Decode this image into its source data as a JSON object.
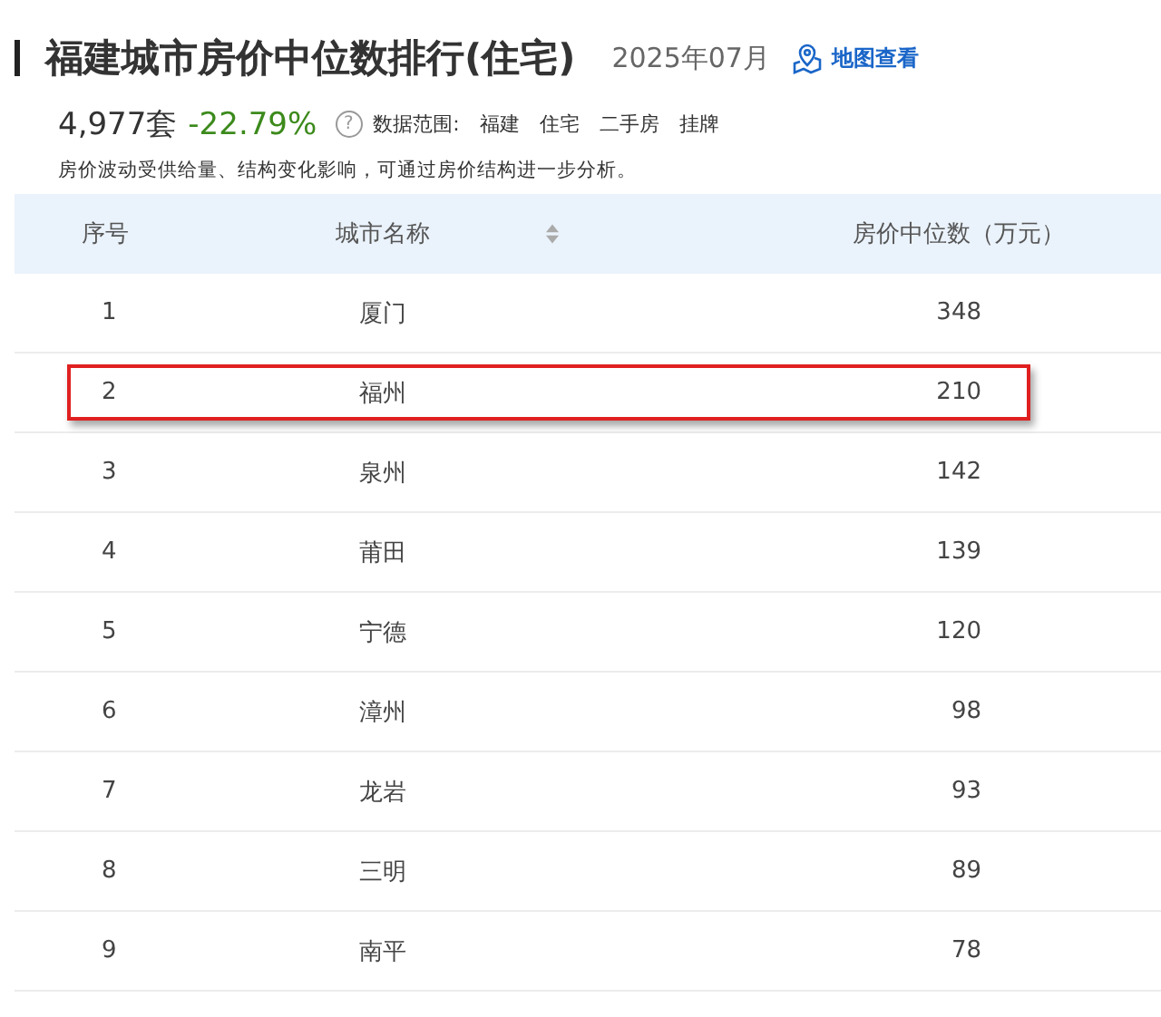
{
  "header": {
    "title": "福建城市房价中位数排行(住宅)",
    "date": "2025年07月",
    "map_link": "地图查看"
  },
  "summary": {
    "count": "4,977套",
    "change": "-22.79%",
    "help": "?",
    "scope_label": "数据范围:",
    "scope": [
      "福建",
      "住宅",
      "二手房",
      "挂牌"
    ],
    "note": "房价波动受供给量、结构变化影响，可通过房价结构进一步分析。"
  },
  "table": {
    "columns": [
      "序号",
      "城市名称",
      "房价中位数（万元）"
    ],
    "rows": [
      {
        "rank": "1",
        "city": "厦门",
        "price": "348",
        "highlighted": false
      },
      {
        "rank": "2",
        "city": "福州",
        "price": "210",
        "highlighted": true
      },
      {
        "rank": "3",
        "city": "泉州",
        "price": "142",
        "highlighted": false
      },
      {
        "rank": "4",
        "city": "莆田",
        "price": "139",
        "highlighted": false
      },
      {
        "rank": "5",
        "city": "宁德",
        "price": "120",
        "highlighted": false
      },
      {
        "rank": "6",
        "city": "漳州",
        "price": "98",
        "highlighted": false
      },
      {
        "rank": "7",
        "city": "龙岩",
        "price": "93",
        "highlighted": false
      },
      {
        "rank": "8",
        "city": "三明",
        "price": "89",
        "highlighted": false
      },
      {
        "rank": "9",
        "city": "南平",
        "price": "78",
        "highlighted": false
      }
    ]
  }
}
